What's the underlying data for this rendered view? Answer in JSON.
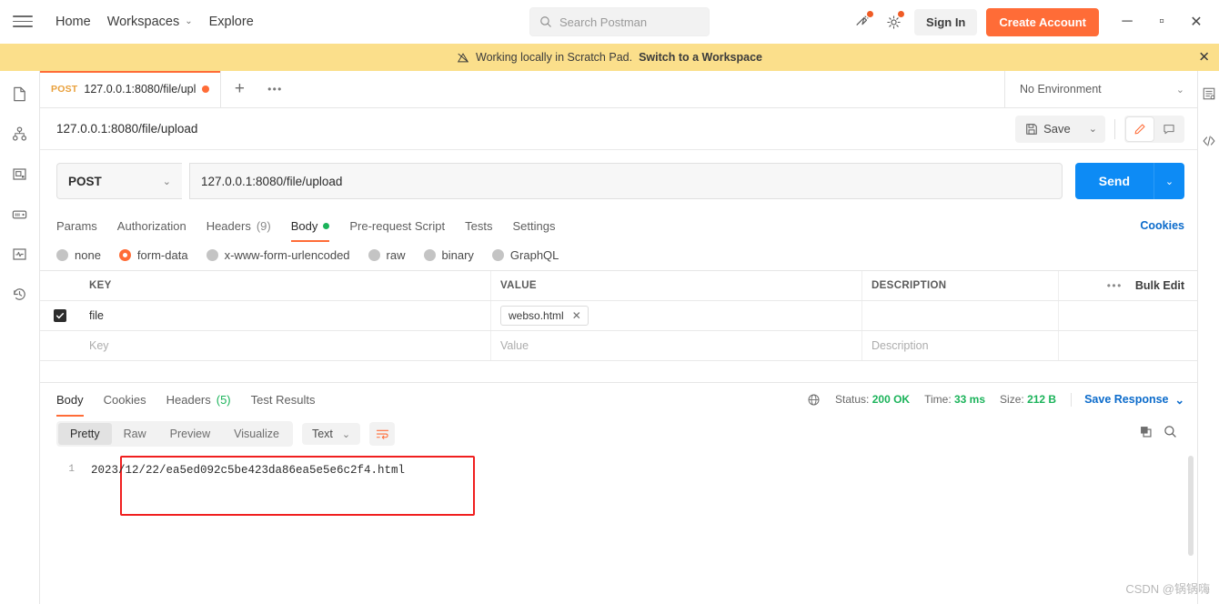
{
  "topbar": {
    "menu_icon": "hamburger-icon",
    "nav": [
      {
        "label": "Home",
        "caret": false
      },
      {
        "label": "Workspaces",
        "caret": true
      },
      {
        "label": "Explore",
        "caret": false
      }
    ],
    "workspaces_chevron": "⌄",
    "search": {
      "placeholder": "Search Postman",
      "icon": "search-icon"
    },
    "invite_icon": "invite-icon",
    "settings_icon": "gear-icon",
    "sign_in": "Sign In",
    "create_account": "Create Account",
    "window": {
      "minimize": "─",
      "maximize": "▫",
      "close": "✕"
    }
  },
  "banner": {
    "icon": "scratchpad-icon",
    "text": "Working locally in Scratch Pad.",
    "link": "Switch to a Workspace",
    "close": "✕"
  },
  "left_rail": [
    {
      "name": "collections-icon"
    },
    {
      "name": "apis-icon"
    },
    {
      "name": "environments-icon"
    },
    {
      "name": "mock-servers-icon"
    },
    {
      "name": "monitors-icon"
    },
    {
      "name": "history-icon"
    }
  ],
  "right_rail": [
    {
      "name": "environment-quick-look-icon"
    },
    {
      "name": "code-snippet-icon"
    }
  ],
  "tabstrip": {
    "tabs": [
      {
        "method": "POST",
        "name": "127.0.0.1:8080/file/upl",
        "unsaved": true,
        "active": true
      }
    ],
    "new_tab": "+",
    "more": "•••",
    "environment": {
      "value": "No Environment",
      "chevron": "⌄"
    }
  },
  "request": {
    "title": "127.0.0.1:8080/file/upload",
    "save_label": "Save",
    "save_caret": "⌄",
    "save_icon": "save-disk-icon",
    "edit_icon": "pencil-icon",
    "comment_icon": "comment-icon",
    "method": "POST",
    "method_caret": "⌄",
    "url": "127.0.0.1:8080/file/upload",
    "send_label": "Send",
    "send_caret": "⌄",
    "tabs": [
      {
        "label": "Params",
        "count": "",
        "active": false,
        "dot": false
      },
      {
        "label": "Authorization",
        "count": "",
        "active": false,
        "dot": false
      },
      {
        "label": "Headers",
        "count": "(9)",
        "active": false,
        "dot": false
      },
      {
        "label": "Body",
        "count": "",
        "active": true,
        "dot": true
      },
      {
        "label": "Pre-request Script",
        "count": "",
        "active": false,
        "dot": false
      },
      {
        "label": "Tests",
        "count": "",
        "active": false,
        "dot": false
      },
      {
        "label": "Settings",
        "count": "",
        "active": false,
        "dot": false
      }
    ],
    "cookies_link": "Cookies",
    "body_types": [
      {
        "label": "none",
        "selected": false
      },
      {
        "label": "form-data",
        "selected": true
      },
      {
        "label": "x-www-form-urlencoded",
        "selected": false
      },
      {
        "label": "raw",
        "selected": false
      },
      {
        "label": "binary",
        "selected": false
      },
      {
        "label": "GraphQL",
        "selected": false
      }
    ],
    "table": {
      "headers": {
        "key": "KEY",
        "value": "VALUE",
        "description": "DESCRIPTION"
      },
      "more_icon": "•••",
      "bulk_edit": "Bulk Edit",
      "rows": [
        {
          "checked": true,
          "key": "file",
          "file_chip": "webso.html",
          "chip_close": "✕",
          "description": ""
        }
      ],
      "placeholder_row": {
        "key": "Key",
        "value": "Value",
        "description": "Description"
      }
    }
  },
  "response": {
    "tabs": [
      {
        "label": "Body",
        "count": "",
        "active": true
      },
      {
        "label": "Cookies",
        "count": "",
        "active": false
      },
      {
        "label": "Headers",
        "count": "(5)",
        "active": false
      },
      {
        "label": "Test Results",
        "count": "",
        "active": false
      }
    ],
    "meta": {
      "globe_icon": "globe-icon",
      "status_label": "Status:",
      "status_value": "200 OK",
      "time_label": "Time:",
      "time_value": "33 ms",
      "size_label": "Size:",
      "size_value": "212 B",
      "save_response": "Save Response",
      "save_caret": "⌄"
    },
    "views": [
      {
        "label": "Pretty",
        "active": true
      },
      {
        "label": "Raw",
        "active": false
      },
      {
        "label": "Preview",
        "active": false
      },
      {
        "label": "Visualize",
        "active": false
      }
    ],
    "format": {
      "value": "Text",
      "caret": "⌄"
    },
    "wrap_icon": "wrap-lines-icon",
    "copy_icon": "copy-icon",
    "search_icon": "search-icon",
    "body": {
      "line_number": "1",
      "text": "2023/12/22/ea5ed092c5be423da86ea5e5e6c2f4.html"
    },
    "highlight_color": "#f01f1f"
  },
  "watermark": "CSDN @锅锅嗨",
  "colors": {
    "accent_orange": "#ff6c37",
    "send_blue": "#0d8bf5",
    "banner_yellow": "#fbdf8b",
    "status_green": "#1bb35a",
    "link_blue": "#0b6bcb"
  }
}
